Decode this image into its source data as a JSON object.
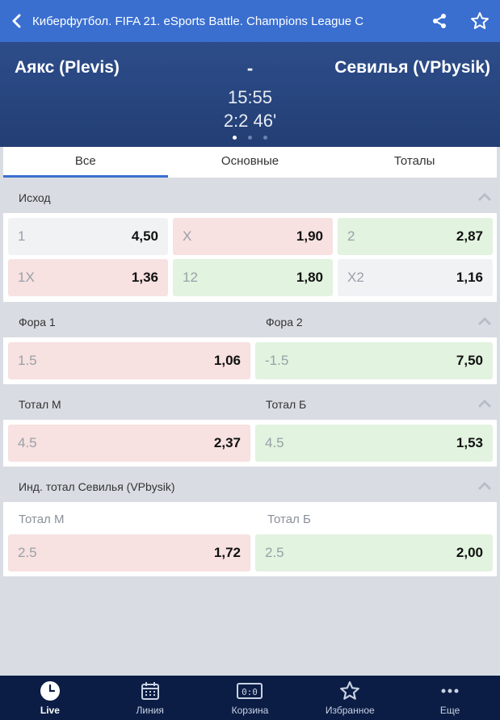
{
  "header": {
    "title": "Киберфутбол. FIFA 21. eSports Battle. Champions League C"
  },
  "match": {
    "team1": "Аякс (Plevis)",
    "team2": "Севилья (VPbysik)",
    "separator": "-",
    "time": "15:55",
    "score": "2:2 46'"
  },
  "tabs": [
    "Все",
    "Основные",
    "Тоталы"
  ],
  "outcome": {
    "title": "Исход",
    "row1": [
      {
        "name": "1",
        "odd": "4,50"
      },
      {
        "name": "X",
        "odd": "1,90"
      },
      {
        "name": "2",
        "odd": "2,87"
      }
    ],
    "row2": [
      {
        "name": "1X",
        "odd": "1,36"
      },
      {
        "name": "12",
        "odd": "1,80"
      },
      {
        "name": "X2",
        "odd": "1,16"
      }
    ]
  },
  "handicap": {
    "title1": "Фора 1",
    "title2": "Фора 2",
    "cells": [
      {
        "name": "1.5",
        "odd": "1,06"
      },
      {
        "name": "-1.5",
        "odd": "7,50"
      }
    ]
  },
  "total": {
    "title1": "Тотал М",
    "title2": "Тотал Б",
    "cells": [
      {
        "name": "4.5",
        "odd": "2,37"
      },
      {
        "name": "4.5",
        "odd": "1,53"
      }
    ]
  },
  "ind_total": {
    "title": "Инд. тотал Севилья (VPbysik)",
    "sub1": "Тотал М",
    "sub2": "Тотал Б",
    "cells": [
      {
        "name": "2.5",
        "odd": "1,72"
      },
      {
        "name": "2.5",
        "odd": "2,00"
      }
    ]
  },
  "nav": [
    {
      "label": "Live",
      "icon": "clock-icon"
    },
    {
      "label": "Линия",
      "icon": "calendar-icon"
    },
    {
      "label": "Корзина",
      "icon": "scoreboard-icon"
    },
    {
      "label": "Избранное",
      "icon": "star-icon"
    },
    {
      "label": "Еще",
      "icon": "more-icon"
    }
  ],
  "colors": {
    "header": "#3a6fd0",
    "scoreboard": "#2d4d8a",
    "nav": "#0b1d45",
    "red_cell": "#f7e1e1",
    "green_cell": "#e2f3df"
  }
}
